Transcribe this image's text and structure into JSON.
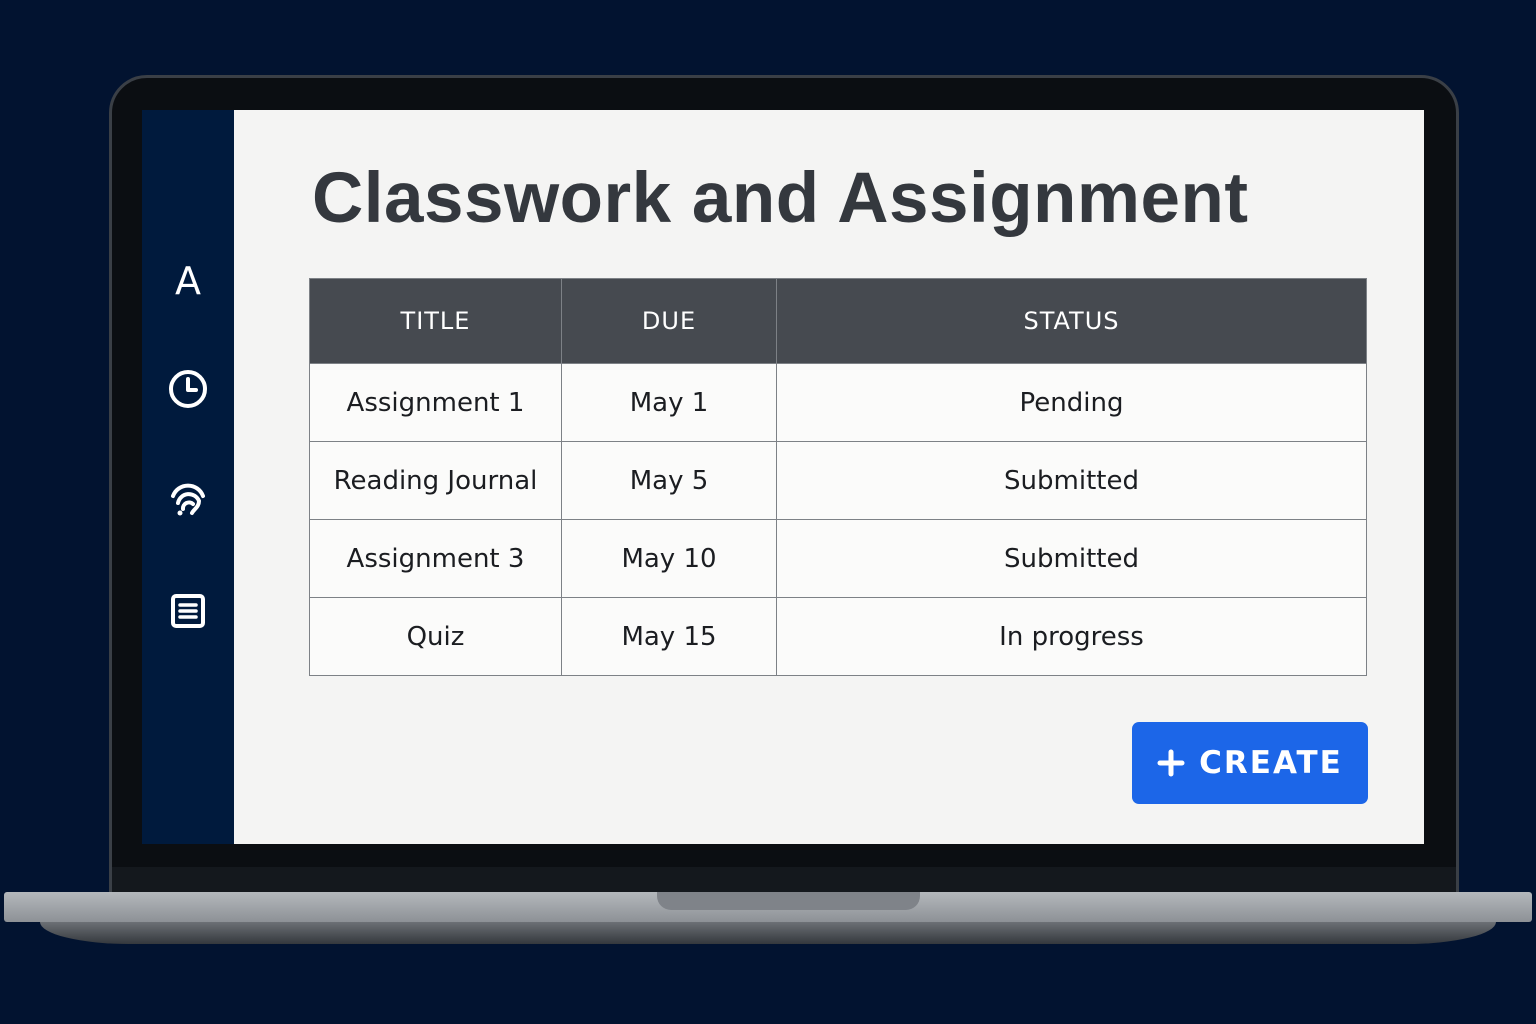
{
  "page": {
    "title": "Classwork and Assignment"
  },
  "sidebar": {
    "items": [
      {
        "icon": "letter-a-icon",
        "label": "A"
      },
      {
        "icon": "clock-icon"
      },
      {
        "icon": "broadcast-icon"
      },
      {
        "icon": "document-list-icon"
      }
    ]
  },
  "table": {
    "columns": [
      "TITLE",
      "DUE",
      "STATUS"
    ],
    "rows": [
      [
        "Assignment 1",
        "May 1",
        "Pending"
      ],
      [
        "Reading Journal",
        "May 5",
        "Submitted"
      ],
      [
        "Assignment 3",
        "May 10",
        "Submitted"
      ],
      [
        "Quiz",
        "May 15",
        "In progress"
      ]
    ]
  },
  "actions": {
    "create_label": "CREATE",
    "create_icon": "plus-icon"
  },
  "colors": {
    "sidebar": "#001a3d",
    "header": "#464a50",
    "accent": "#1c66e8",
    "background": "#021330"
  }
}
